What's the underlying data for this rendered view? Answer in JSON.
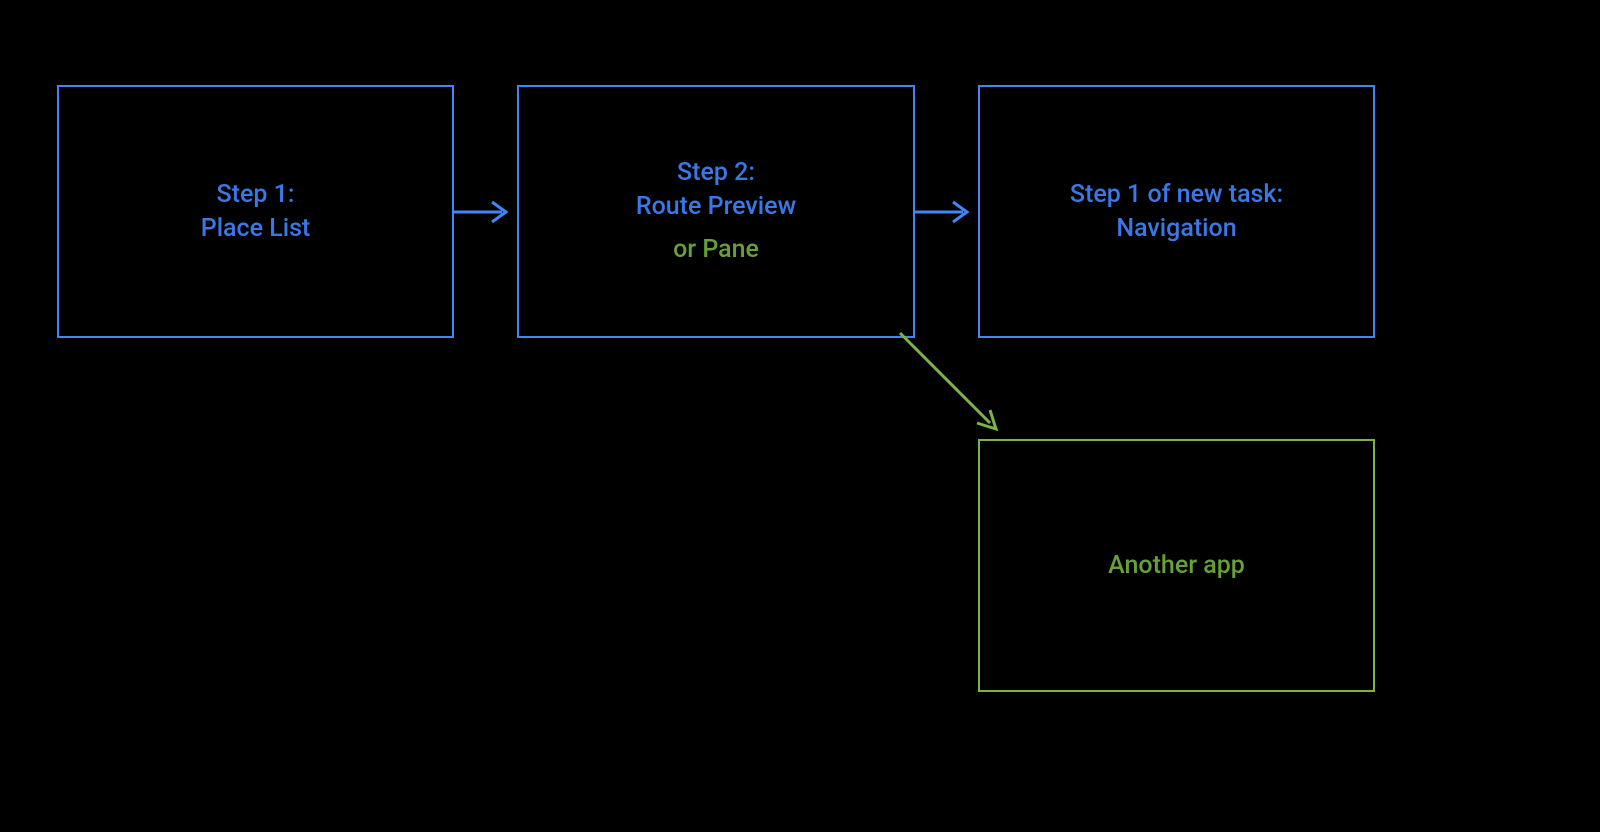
{
  "colors": {
    "blue": "#4285f4",
    "green": "#7cb342",
    "blueText": "#3b78e7",
    "greenText": "#689f38"
  },
  "boxes": {
    "step1": {
      "title_line1": "Step 1:",
      "title_line2": "Place List"
    },
    "step2": {
      "title_line1": "Step 2:",
      "title_line2": "Route Preview",
      "subtitle": "or Pane"
    },
    "step3": {
      "title_line1": "Step 1 of new task:",
      "title_line2": "Navigation"
    },
    "another": {
      "label": "Another app"
    }
  }
}
